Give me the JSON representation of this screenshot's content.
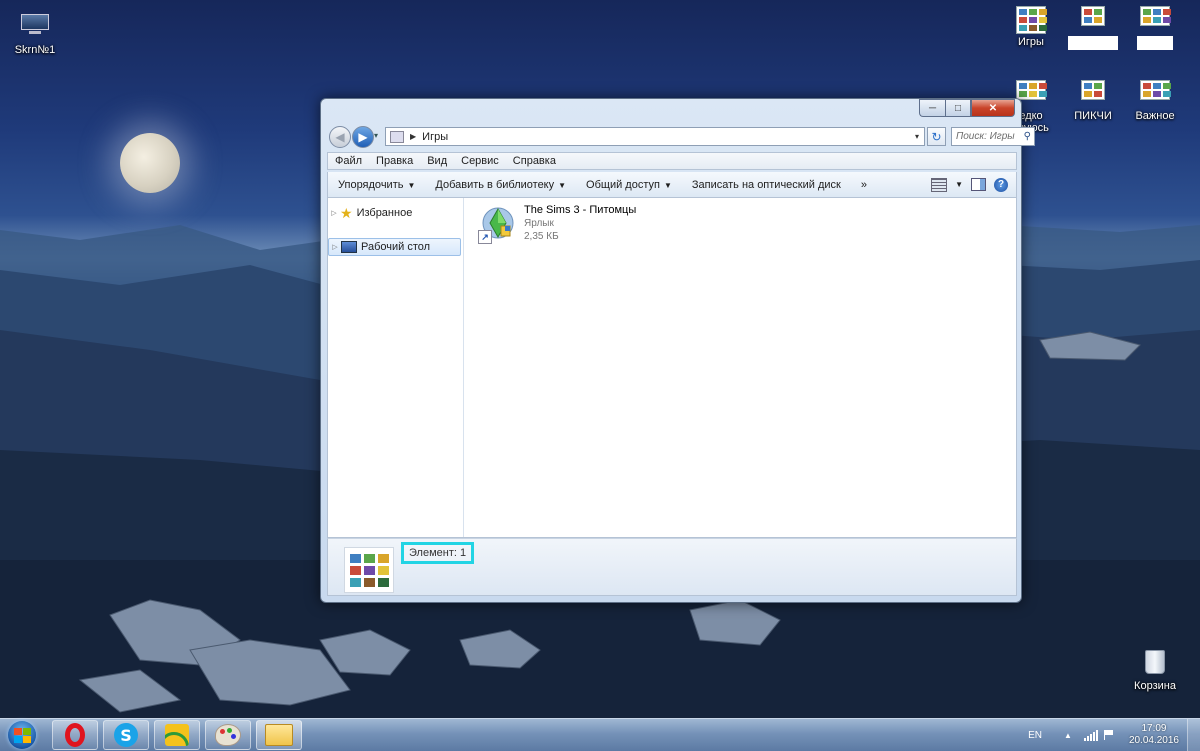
{
  "desktop": {
    "icons": [
      {
        "label": "Skrn№1"
      },
      {
        "label": "Игры"
      },
      {
        "label": ""
      },
      {
        "label": ""
      },
      {
        "label": "едко\nьзуюсь"
      },
      {
        "label": "ПИКЧИ"
      },
      {
        "label": "Важное"
      },
      {
        "label": "Корзина"
      }
    ]
  },
  "window": {
    "title_buttons": {
      "minimize": "─",
      "maximize": "□",
      "close": "✕"
    },
    "address": {
      "crumb": "Игры",
      "back": "◀",
      "forward": "▶",
      "recent": "▾",
      "dropdown": "▾",
      "refresh": "↻"
    },
    "search": {
      "placeholder": "Поиск: Игры",
      "icon": "⚲"
    },
    "menu": [
      "Файл",
      "Правка",
      "Вид",
      "Сервис",
      "Справка"
    ],
    "commands": [
      {
        "label": "Упорядочить",
        "arrow": "▼"
      },
      {
        "label": "Добавить в библиотеку",
        "arrow": "▼"
      },
      {
        "label": "Общий доступ",
        "arrow": "▼"
      },
      {
        "label": "Записать на оптический диск",
        "arrow": ""
      },
      {
        "label": "»",
        "arrow": ""
      }
    ],
    "help": "?",
    "view_arrow": "▼",
    "nav": [
      {
        "label": "Избранное",
        "tri": "▷",
        "icon": "★"
      },
      {
        "label": "Рабочий стол",
        "tri": "▷"
      }
    ],
    "file": {
      "name": "The Sims 3 - Питомцы",
      "type": "Ярлык",
      "size": "2,35 КБ",
      "shortcut": "↗"
    },
    "status": {
      "count": "Элемент: 1"
    }
  },
  "taskbar": {
    "tray": {
      "lang": "EN",
      "chevron": "▲",
      "time": "17:09",
      "date": "20.04.2016"
    },
    "skype_letter": "S"
  },
  "colors": {
    "highlight": "#22d4e4",
    "thumbs": [
      "#3f7fc1",
      "#5aa64a",
      "#d9a52a",
      "#c94b3a",
      "#6f4aa8",
      "#e2c33a",
      "#3aa0b5",
      "#8a5a2a",
      "#2c6b3c"
    ]
  }
}
